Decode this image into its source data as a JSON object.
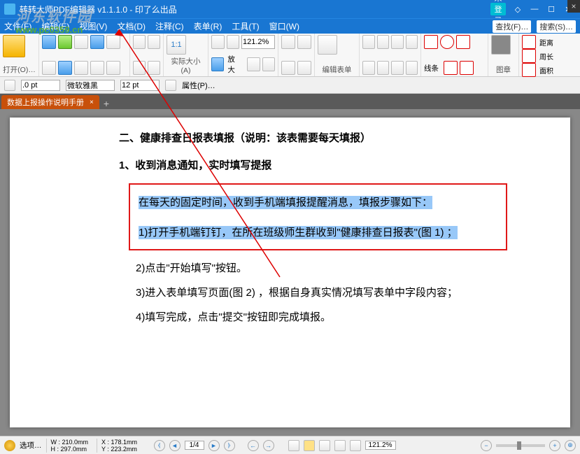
{
  "window": {
    "title": "转转大师PDF编辑器 v1.1.1.0 - 印了么出品",
    "login": "未登录"
  },
  "watermark": {
    "site": "河东软件园",
    "url": "www.pc0359.cn"
  },
  "menu": {
    "items": [
      "文件(F)",
      "编辑(E)",
      "视图(V)",
      "文档(D)",
      "注释(C)",
      "表单(R)",
      "工具(T)",
      "窗口(W)"
    ],
    "find": "查找(F)…",
    "search": "搜索(S)…"
  },
  "ribbon": {
    "open": "打开(O)…",
    "actual": "实际大小(A)",
    "zoomin": "放大",
    "zoomval": "121.2%",
    "editform": "编辑表单",
    "line": "线条",
    "image": "图章",
    "dist": "距离",
    "perim": "周长",
    "area": "面积"
  },
  "sub": {
    "pt1": ".0 pt",
    "font": "微软雅黑",
    "pt2": "12 pt",
    "prop": "属性(P)…"
  },
  "tab": {
    "name": "数据上报操作说明手册"
  },
  "doc": {
    "h": "二、健康排查日报表填报（说明：该表需要每天填报）",
    "sub": "1、收到消息通知，实时填写提报",
    "hl1": "在每天的固定时间，收到手机端填报提醒消息，填报步骤如下：",
    "hl2": "1)打开手机端钉钉，在所在班级师生群收到\"健康排查日报表\"(图 1) ；",
    "p2": "2)点击\"开始填写\"按钮。",
    "p3": "3)进入表单填写页面(图 2) ，根据自身真实情况填写表单中字段内容；",
    "p4": "4)填写完成，点击\"提交\"按钮即完成填报。"
  },
  "status": {
    "opt": "选项…",
    "w": "W : 210.0mm",
    "h": "H : 297.0mm",
    "x": "X : 178.1mm",
    "y": "Y : 223.2mm",
    "page": "1/4",
    "zoom": "121.2%"
  }
}
